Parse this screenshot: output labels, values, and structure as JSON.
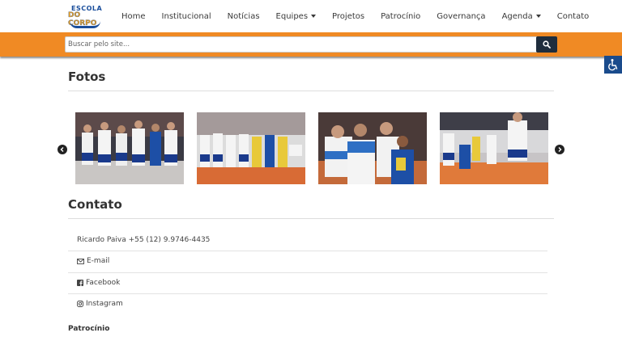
{
  "logo": {
    "line1": "ESCOLA",
    "line2": "DO CORPO"
  },
  "nav": {
    "items": [
      {
        "label": "Home",
        "dropdown": false
      },
      {
        "label": "Institucional",
        "dropdown": false
      },
      {
        "label": "Notícias",
        "dropdown": false
      },
      {
        "label": "Equipes",
        "dropdown": true
      },
      {
        "label": "Projetos",
        "dropdown": false
      },
      {
        "label": "Patrocínio",
        "dropdown": false
      },
      {
        "label": "Governança",
        "dropdown": false
      },
      {
        "label": "Agenda",
        "dropdown": true
      },
      {
        "label": "Contato",
        "dropdown": false
      }
    ]
  },
  "search": {
    "placeholder": "Buscar pelo site...",
    "button_icon": "search-icon"
  },
  "accessibility": {
    "icon": "wheelchair-icon"
  },
  "fotos": {
    "title": "Fotos",
    "prev_icon": "chevron-left-icon",
    "next_icon": "chevron-right-icon"
  },
  "contato": {
    "title": "Contato",
    "items": [
      {
        "icon": "",
        "text": "Ricardo Paiva +55 (12) 9.9746-4435"
      },
      {
        "icon": "envelope-icon",
        "text": "E-mail"
      },
      {
        "icon": "facebook-icon",
        "text": "Facebook"
      },
      {
        "icon": "instagram-icon",
        "text": "Instagram"
      }
    ]
  },
  "patrocinio": {
    "title": "Patrocínio"
  },
  "colors": {
    "orange": "#f08a24",
    "navy": "#1f2d3d",
    "access_blue": "#1a4b8c"
  }
}
